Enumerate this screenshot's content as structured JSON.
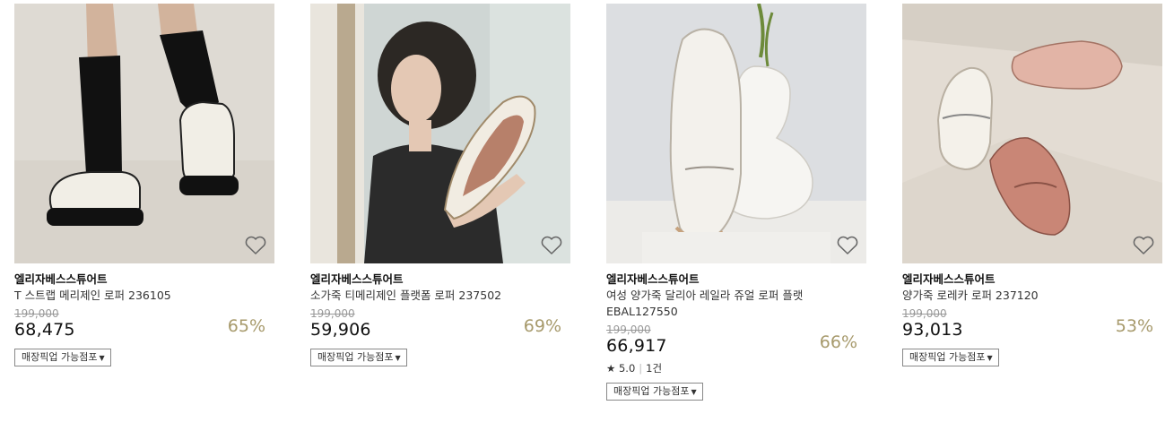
{
  "products": [
    {
      "brand": "엘리자베스스튜어트",
      "title": "T 스트랩 메리제인 로퍼 236105",
      "original_price": "199,000",
      "sale_price": "68,475",
      "discount": "65%",
      "pickup_label": "매장픽업 가능점포",
      "wishlist_icon": "heart-outline-icon",
      "image_colors": [
        "#d9d4cc",
        "#111111",
        "#f1eee6"
      ]
    },
    {
      "brand": "엘리자베스스튜어트",
      "title": "소가죽 티메리제인 플랫폼 로퍼 237502",
      "original_price": "199,000",
      "sale_price": "59,906",
      "discount": "69%",
      "pickup_label": "매장픽업 가능점포",
      "wishlist_icon": "heart-outline-icon",
      "image_colors": [
        "#c9d4d2",
        "#2b2b2b",
        "#f1ece2"
      ]
    },
    {
      "brand": "엘리자베스스튜어트",
      "title": "여성 양가죽 달리아 레일라 쥬얼 로퍼 플랫",
      "title_line2": "EBAL127550",
      "original_price": "199,000",
      "sale_price": "66,917",
      "discount": "66%",
      "rating": "5.0",
      "review_count": "1건",
      "pickup_label": "매장픽업 가능점포",
      "wishlist_icon": "heart-outline-icon",
      "image_colors": [
        "#d8dadd",
        "#f3f1ec",
        "#b5b0a6"
      ]
    },
    {
      "brand": "엘리자베스스튜어트",
      "title": "양가죽 로레카 로퍼 237120",
      "original_price": "199,000",
      "sale_price": "93,013",
      "discount": "53%",
      "pickup_label": "매장픽업 가능점포",
      "wishlist_icon": "heart-outline-icon",
      "image_colors": [
        "#d6cec4",
        "#c98676",
        "#e6b8a8"
      ]
    }
  ],
  "colors": {
    "discount": "#a79a6c",
    "original_price": "#999999",
    "text": "#222222"
  }
}
